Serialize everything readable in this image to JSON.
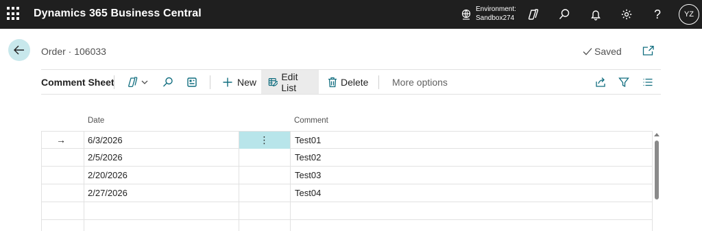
{
  "appbar": {
    "title": "Dynamics 365 Business Central",
    "environment_label": "Environment:",
    "environment_name": "Sandbox274",
    "help_glyph": "?",
    "user_initials": "YZ",
    "icons": [
      "waffle-icon",
      "environment-icon",
      "copilot-icon",
      "search-icon",
      "bell-icon",
      "gear-icon",
      "help-icon"
    ]
  },
  "header": {
    "breadcrumb": "Order · 106033",
    "status": "Saved"
  },
  "actionbar": {
    "page_name": "Comment Sheet",
    "new_label": "New",
    "edit_list_label": "Edit List",
    "delete_label": "Delete",
    "more_options_label": "More options"
  },
  "grid": {
    "columns": [
      "Date",
      "Comment"
    ],
    "rows": [
      {
        "date": "6/3/2026",
        "comment": "Test01"
      },
      {
        "date": "2/5/2026",
        "comment": "Test02"
      },
      {
        "date": "2/20/2026",
        "comment": "Test03"
      },
      {
        "date": "2/27/2026",
        "comment": "Test04"
      }
    ],
    "current_row_indicator": "→",
    "row_action_glyph": "⋮"
  },
  "colors": {
    "appbar_bg": "#1f1f1f",
    "accent": "#b8e5ea",
    "back_button_bg": "#c8e8ec"
  }
}
